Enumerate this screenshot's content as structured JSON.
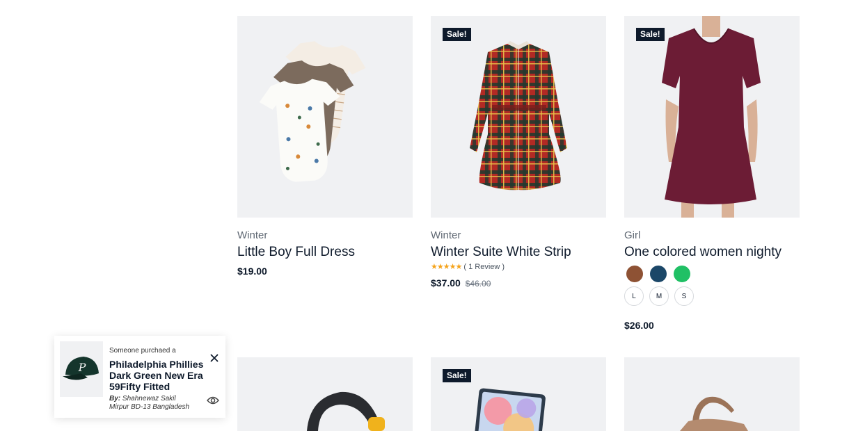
{
  "products": [
    {
      "category": "Winter",
      "title": "Little Boy Full Dress",
      "price": "$19.00"
    },
    {
      "category": "Winter",
      "title": "Winter Suite White Strip",
      "sale": "Sale!",
      "rating_text": "( 1 Review )",
      "rating": 5,
      "price": "$37.00",
      "old_price": "$46.00"
    },
    {
      "category": "Girl",
      "title": "One colored women nighty",
      "sale": "Sale!",
      "price": "$26.00",
      "colors": [
        "#8e5234",
        "#1b4768",
        "#20c065"
      ],
      "sizes": [
        "L",
        "M",
        "S"
      ]
    }
  ],
  "row2": [
    {
      "sale": ""
    },
    {
      "sale": "Sale!"
    },
    {
      "sale": ""
    }
  ],
  "popup": {
    "lead": "Someone purchaed a",
    "product": "Philadelphia Phillies Dark Green New Era 59Fifty Fitted",
    "by_label": "By:",
    "by_name": "Shahnewaz Sakil",
    "location": "Mirpur BD-13 Bangladesh"
  }
}
